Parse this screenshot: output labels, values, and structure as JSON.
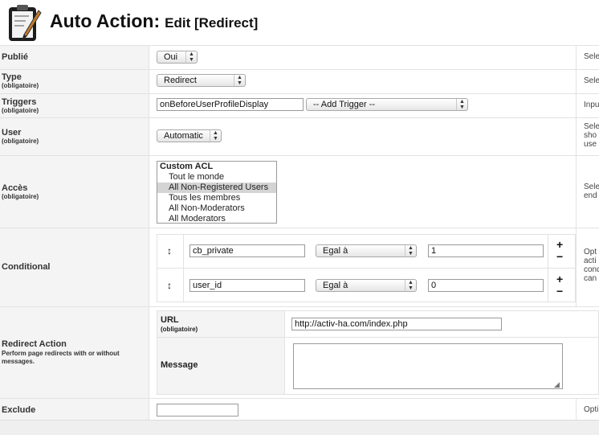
{
  "header": {
    "title_main": "Auto Action:",
    "title_sub": "Edit [Redirect]",
    "logo_icon": "clipboard-pen-icon"
  },
  "fields": {
    "publie": {
      "label": "Publié",
      "value": "Oui",
      "help": "Sele"
    },
    "type": {
      "label": "Type",
      "required": "(obligatoire)",
      "value": "Redirect",
      "help": "Sele"
    },
    "triggers": {
      "label": "Triggers",
      "required": "(obligatoire)",
      "value": "onBeforeUserProfileDisplay",
      "add_trigger": "-- Add Trigger --",
      "help": "Inpu"
    },
    "user": {
      "label": "User",
      "required": "(obligatoire)",
      "value": "Automatic",
      "help_lines": [
        "Sele",
        "sho",
        "use"
      ]
    },
    "acces": {
      "label": "Accès",
      "required": "(obligatoire)",
      "options": [
        {
          "text": "Custom ACL",
          "group": true,
          "selected": false
        },
        {
          "text": "Tout le monde",
          "group": false,
          "selected": false
        },
        {
          "text": "All Non-Registered Users",
          "group": false,
          "selected": true
        },
        {
          "text": "Tous les membres",
          "group": false,
          "selected": false
        },
        {
          "text": "All Non-Moderators",
          "group": false,
          "selected": false
        },
        {
          "text": "All Moderators",
          "group": false,
          "selected": false
        }
      ],
      "help_lines": [
        "Sele",
        "end"
      ]
    },
    "conditional": {
      "label": "Conditional",
      "rows": [
        {
          "field": "cb_private",
          "operator": "Egal à",
          "value": "1"
        },
        {
          "field": "user_id",
          "operator": "Egal à",
          "value": "0"
        }
      ],
      "add_symbol": "+",
      "remove_symbol": "−",
      "move_symbol": "↕",
      "help_lines": [
        "Opt",
        "acti",
        "cond",
        "can"
      ]
    },
    "redirect_action": {
      "label": "Redirect Action",
      "description": "Perform page redirects with or without messages.",
      "url_label": "URL",
      "url_required": "(obligatoire)",
      "url_value": "http://activ-ha.com/index.php",
      "message_label": "Message",
      "message_value": ""
    },
    "exclude": {
      "label": "Exclude",
      "value": "",
      "help": "Opti"
    }
  }
}
